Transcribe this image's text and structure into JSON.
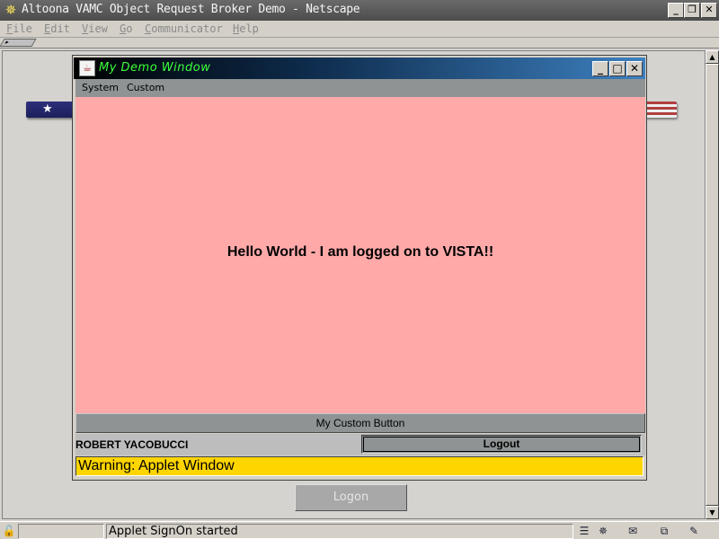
{
  "browser": {
    "title": "Altoona VAMC Object Request Broker Demo - Netscape",
    "menu": [
      "File",
      "Edit",
      "View",
      "Go",
      "Communicator",
      "Help"
    ],
    "status_text": "Applet SignOn started"
  },
  "page": {
    "logon_label": "Logon"
  },
  "applet": {
    "title": "My Demo Window",
    "menu": [
      "System",
      "Custom"
    ],
    "message": "Hello World - I am logged on to VISTA!!",
    "custom_button_label": "My Custom Button",
    "user_name": "ROBERT YACOBUCCI",
    "logout_label": "Logout",
    "warning": "Warning: Applet Window",
    "body_color": "#ffa9a9",
    "warning_color": "#ffd500",
    "title_text_color": "#3cff3c"
  },
  "icons": {
    "browser_logo": "netscape-logo-icon",
    "applet_icon": "java-cup-icon",
    "lock": "security-lock-icon",
    "tray": [
      "component-bar-icon",
      "navigator-icon",
      "mail-icon",
      "discussion-icon",
      "composer-icon"
    ]
  }
}
